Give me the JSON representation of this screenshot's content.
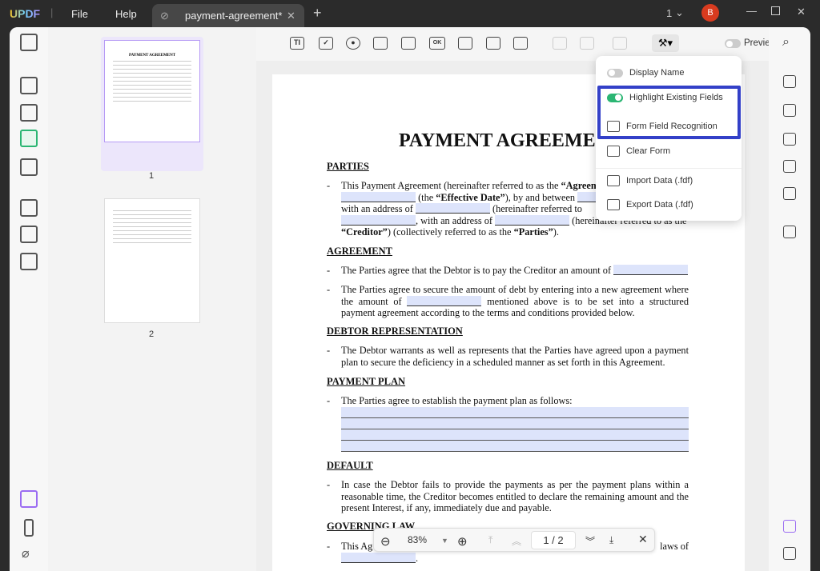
{
  "app": {
    "logo": "UPDF",
    "menu": [
      "File",
      "Help"
    ],
    "tab_title": "payment-agreement*",
    "window_count": "1",
    "avatar": "B"
  },
  "toolbar": {
    "preview_label": "Preview",
    "icons": [
      "text-field",
      "checkbox",
      "radio-button",
      "combo-box",
      "list-box",
      "button",
      "date-field",
      "image-field",
      "signature-field"
    ]
  },
  "thumbnails": [
    {
      "page": "1",
      "title": "PAYMENT AGREEMENT"
    },
    {
      "page": "2"
    }
  ],
  "dropdown": {
    "items": [
      {
        "label": "Display Name",
        "toggle": false
      },
      {
        "label": "Highlight Existing Fields",
        "toggle": true
      },
      {
        "label": "Form Field Recognition"
      },
      {
        "label": "Clear Form"
      },
      {
        "label": "Import Data (.fdf)"
      },
      {
        "label": "Export Data (.fdf)"
      }
    ]
  },
  "document": {
    "title": "PAYMENT AGREEMENT",
    "sections": {
      "parties": "PARTIES",
      "parties_text": [
        "This Payment Agreement (hereinafter referred to as the ",
        "“Agreem",
        "(the ",
        "“Effective Date”",
        "), by and between",
        "with an address of",
        "(hereinafter referred to",
        ", with an address of",
        "(hereinafter referred to as the",
        "“Creditor”",
        ") (collectively referred to as the ",
        "“Parties”",
        "). "
      ],
      "agreement": "AGREEMENT",
      "agreement_1": "The Parties agree that the Debtor is to pay the Creditor an amount of",
      "agreement_2a": "The Parties agree to secure the amount of debt by entering into a new agreement where the amount of",
      "agreement_2b": "mentioned above is to be set into a structured payment agreement according to the terms and conditions provided below.",
      "debtor": "DEBTOR REPRESENTATION",
      "debtor_1": "The Debtor warrants as well as represents that the Parties have agreed upon a payment plan to secure the deficiency in a scheduled manner as set forth in this Agreement.",
      "plan": "PAYMENT PLAN",
      "plan_1": "The Parties agree to establish the payment plan as follows:",
      "default": "DEFAULT",
      "default_1": "In case the Debtor fails to provide the payments as per the payment plans within a reasonable time, the Creditor becomes entitled to declare the remaining amount and the present Interest, if any, immediately due and payable.",
      "governing": "GOVERNING LAW",
      "governing_1a": "This Ag",
      "governing_1b": "laws of"
    }
  },
  "zoombar": {
    "zoom": "83%",
    "page": "1 / 2"
  },
  "colors": {
    "accent": "#2bb673",
    "highlight_box": "#3340c8",
    "field": "#dde4fb",
    "avatar": "#d83b1f"
  }
}
